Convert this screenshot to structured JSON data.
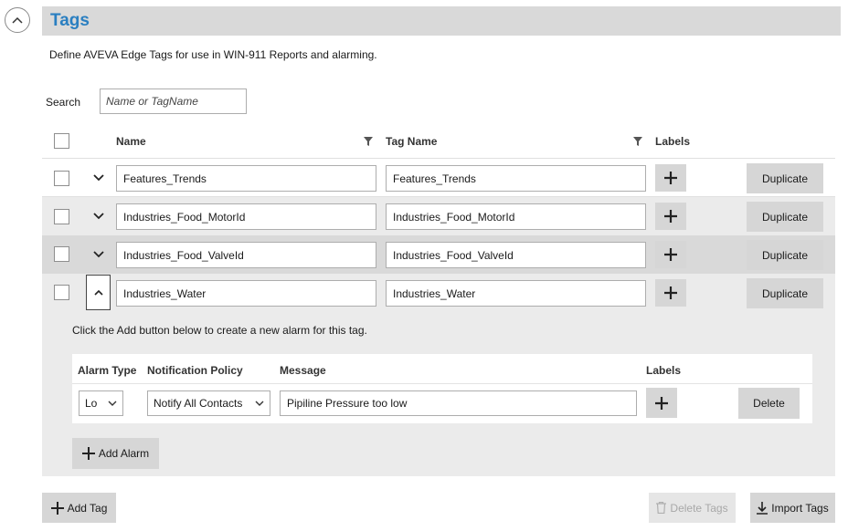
{
  "section": {
    "title": "Tags",
    "description": "Define AVEVA Edge Tags for use in WIN-911 Reports and alarming."
  },
  "search": {
    "label": "Search",
    "placeholder": "Name or TagName"
  },
  "columns": {
    "name": "Name",
    "tag_name": "Tag Name",
    "labels": "Labels"
  },
  "rows": [
    {
      "name": "Features_Trends",
      "tag_name": "Features_Trends",
      "duplicate_label": "Duplicate",
      "expanded": false
    },
    {
      "name": "Industries_Food_MotorId",
      "tag_name": "Industries_Food_MotorId",
      "duplicate_label": "Duplicate",
      "expanded": false
    },
    {
      "name": "Industries_Food_ValveId",
      "tag_name": "Industries_Food_ValveId",
      "duplicate_label": "Duplicate",
      "expanded": false
    },
    {
      "name": "Industries_Water",
      "tag_name": "Industries_Water",
      "duplicate_label": "Duplicate",
      "expanded": true
    }
  ],
  "alarm_panel": {
    "hint": "Click the Add button below to create a new alarm for this tag.",
    "headers": {
      "alarm_type": "Alarm Type",
      "notification_policy": "Notification Policy",
      "message": "Message",
      "labels": "Labels"
    },
    "alarm": {
      "alarm_type": "Lo",
      "notification_policy": "Notify All Contacts",
      "message": "Pipiline Pressure too low",
      "delete_label": "Delete"
    },
    "add_alarm_label": "Add Alarm"
  },
  "footer": {
    "add_tag_label": "Add Tag",
    "delete_tags_label": "Delete Tags",
    "import_tags_label": "Import Tags"
  },
  "colors": {
    "title": "#2a7fc1",
    "header_bar": "#d9d9d9",
    "button": "#d6d6d6",
    "selected_row": "#d9d9d9",
    "expanded_panel": "#ebebeb"
  }
}
